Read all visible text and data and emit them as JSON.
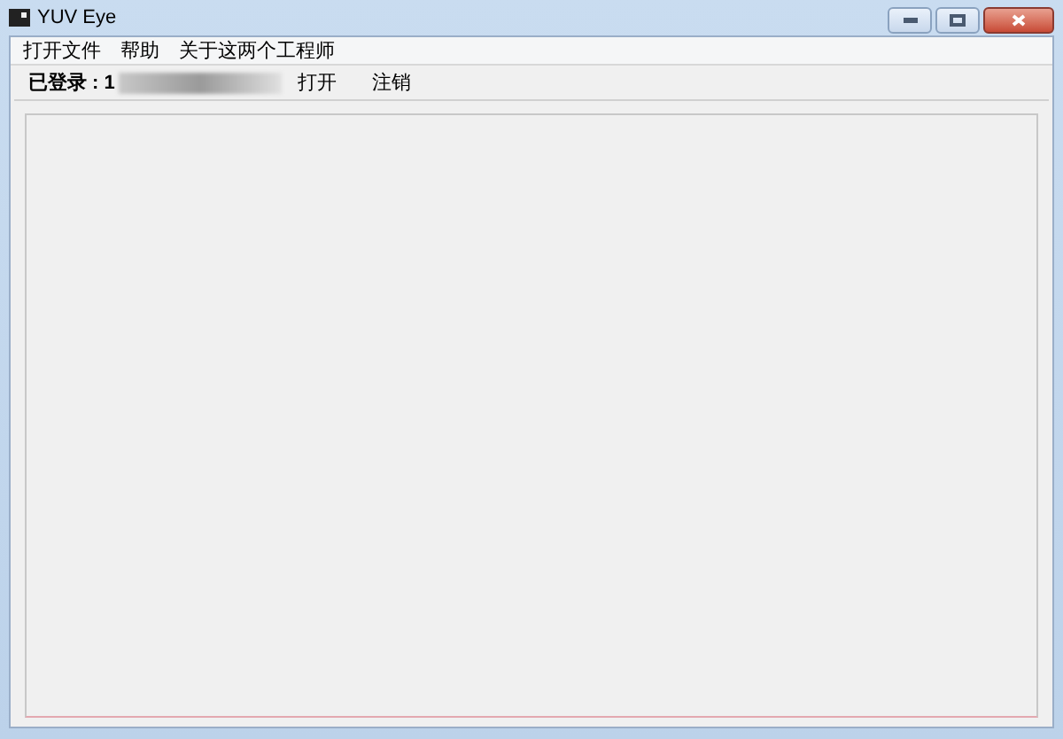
{
  "window": {
    "title": "YUV Eye"
  },
  "menu": [
    "打开文件",
    "帮助",
    "关于这两个工程师"
  ],
  "toolbar": {
    "login_label": "已登录 : 1",
    "buttons": [
      "打开",
      "注销"
    ]
  }
}
